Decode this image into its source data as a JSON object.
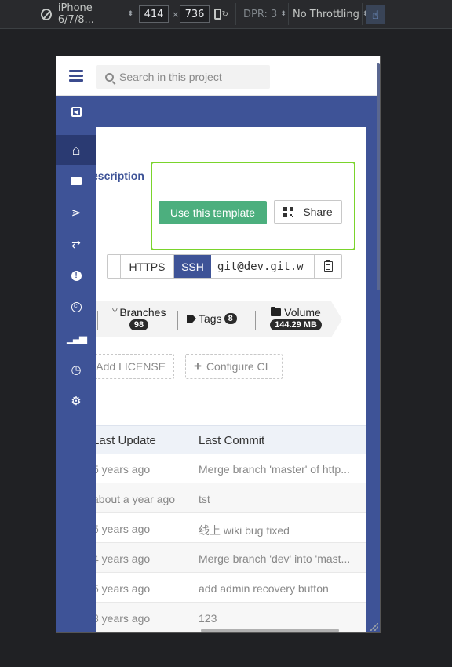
{
  "devtools": {
    "device": "iPhone 6/7/8...",
    "width": "414",
    "times": "×",
    "height": "736",
    "dpr": "DPR: 3",
    "throttling": "No Throttling"
  },
  "topbar": {
    "search_placeholder": "Search in this project"
  },
  "sidebar": {
    "items": [
      {
        "name": "collapse-icon",
        "glyph": "◂"
      },
      {
        "name": "home-icon",
        "glyph": "⌂"
      },
      {
        "name": "folder-icon",
        "glyph": "▬"
      },
      {
        "name": "branch-network-icon",
        "glyph": "⋗"
      },
      {
        "name": "merge-request-icon",
        "glyph": "⇄"
      },
      {
        "name": "issues-icon",
        "glyph": "!"
      },
      {
        "name": "ci-icon",
        "glyph": "©"
      },
      {
        "name": "stats-icon",
        "glyph": "▮"
      },
      {
        "name": "clock-icon",
        "glyph": "◷"
      },
      {
        "name": "settings-icon",
        "glyph": "⚙"
      }
    ]
  },
  "project": {
    "description_link": "escription",
    "use_template_label": "Use this template",
    "share_label": "Share",
    "clone": {
      "https_label": "HTTPS",
      "ssh_label": "SSH",
      "url": "git@dev.git.w"
    },
    "stats": {
      "branches_label": "Branches",
      "branches_count": "98",
      "tags_label": "Tags",
      "tags_count": "8",
      "volume_label": "Volume",
      "volume_value": "144.29 MB"
    },
    "add_license_label": "Add LICENSE",
    "configure_ci_label": "Configure CI"
  },
  "table": {
    "col_update": "Last Update",
    "col_commit": "Last Commit",
    "rows": [
      {
        "update": "5 years ago",
        "commit": "Merge branch 'master' of http..."
      },
      {
        "update": "about a year ago",
        "commit": "tst"
      },
      {
        "update": "5 years ago",
        "commit": "线上 wiki bug fixed"
      },
      {
        "update": "4 years ago",
        "commit": "Merge branch 'dev' into 'mast..."
      },
      {
        "update": "5 years ago",
        "commit": "add admin recovery button"
      },
      {
        "update": "3 years ago",
        "commit": "123"
      }
    ]
  },
  "colors": {
    "brand_blue": "#3e5397",
    "template_green": "#4caf7e",
    "highlight_green": "#7ad42c"
  }
}
